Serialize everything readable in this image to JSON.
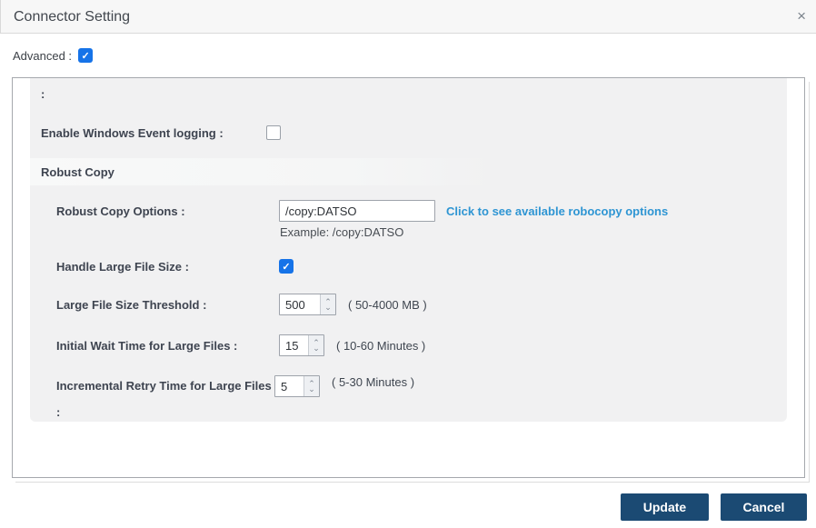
{
  "header": {
    "title": "Connector Setting"
  },
  "glyphs": {
    "close": "×",
    "check": "✓",
    "spin_up": "⌃",
    "spin_down": "⌄"
  },
  "advanced": {
    "label": "Advanced :",
    "checked": true
  },
  "form": {
    "partial_label": ":",
    "event_logging_label": "Enable Windows Event logging :",
    "event_logging_checked": false,
    "section_title": "Robust Copy",
    "options_label": "Robust Copy Options :",
    "options_value": "/copy:DATSO",
    "options_link": "Click to see available robocopy options",
    "options_example": "Example: /copy:DATSO",
    "handle_label": "Handle Large File Size :",
    "handle_checked": true,
    "threshold_label": "Large File Size Threshold :",
    "threshold_value": "500",
    "threshold_hint": "( 50-4000 MB )",
    "wait_label": "Initial Wait Time for Large Files :",
    "wait_value": "15",
    "wait_hint": "( 10-60 Minutes )",
    "retry_label": "Incremental Retry Time for Large Files :",
    "retry_value": "5",
    "retry_hint": "( 5-30 Minutes )"
  },
  "footer": {
    "update_label": "Update",
    "cancel_label": "Cancel"
  },
  "colors": {
    "accent_blue": "#1673e8",
    "link_blue": "#2e95d3",
    "button_navy": "#1b4a73",
    "panel_gray": "#f1f1f2",
    "header_gray": "#f7f7f7"
  }
}
